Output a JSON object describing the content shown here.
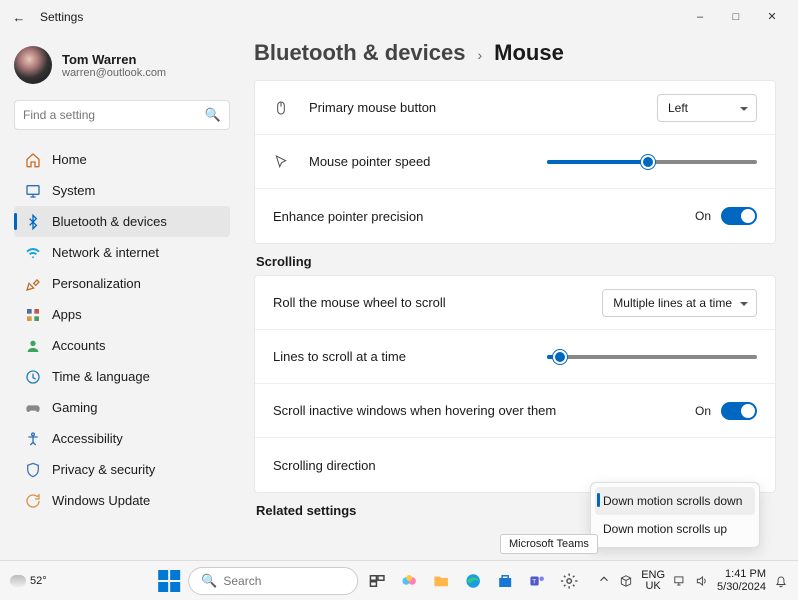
{
  "window": {
    "title": "Settings"
  },
  "user": {
    "name": "Tom Warren",
    "email": "warren@outlook.com"
  },
  "search": {
    "placeholder": "Find a setting"
  },
  "nav": {
    "home": "Home",
    "system": "System",
    "bluetooth": "Bluetooth & devices",
    "network": "Network & internet",
    "personalization": "Personalization",
    "apps": "Apps",
    "accounts": "Accounts",
    "time": "Time & language",
    "gaming": "Gaming",
    "accessibility": "Accessibility",
    "privacy": "Privacy & security",
    "update": "Windows Update"
  },
  "breadcrumb": {
    "parent": "Bluetooth & devices",
    "current": "Mouse"
  },
  "settings": {
    "primary_button": {
      "label": "Primary mouse button",
      "value": "Left"
    },
    "pointer_speed": {
      "label": "Mouse pointer speed",
      "percent": 48
    },
    "enhance_precision": {
      "label": "Enhance pointer precision",
      "state": "On"
    },
    "scrolling_header": "Scrolling",
    "wheel_scroll": {
      "label": "Roll the mouse wheel to scroll",
      "value": "Multiple lines at a time"
    },
    "lines_at_time": {
      "label": "Lines to scroll at a time",
      "percent": 6
    },
    "inactive_windows": {
      "label": "Scroll inactive windows when hovering over them",
      "state": "On"
    },
    "scroll_direction": {
      "label": "Scrolling direction",
      "option_down": "Down motion scrolls down",
      "option_up": "Down motion scrolls up"
    },
    "related_header": "Related settings"
  },
  "tooltip": "Microsoft Teams",
  "taskbar": {
    "temp": "52°",
    "search_placeholder": "Search",
    "lang1": "ENG",
    "lang2": "UK",
    "time": "1:41 PM",
    "date": "5/30/2024"
  }
}
